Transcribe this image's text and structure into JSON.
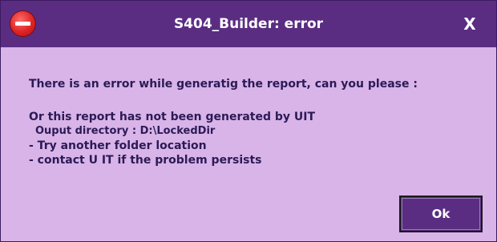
{
  "window": {
    "title": "S404_Builder: error",
    "close_label": "X",
    "icon": "stop-icon"
  },
  "message": {
    "line1": "There is an error while generatig the report, can you please :",
    "line2": "Or this report has not been generated by UIT",
    "line3": "Ouput directory : D:\\LockedDir",
    "line4": "- Try another folder location",
    "line5": "- contact U IT if the problem persists"
  },
  "buttons": {
    "ok_label": "Ok"
  },
  "colors": {
    "titlebar": "#5a2d82",
    "body": "#d8b4e9",
    "text": "#2c1a55",
    "icon": "#e02424"
  }
}
